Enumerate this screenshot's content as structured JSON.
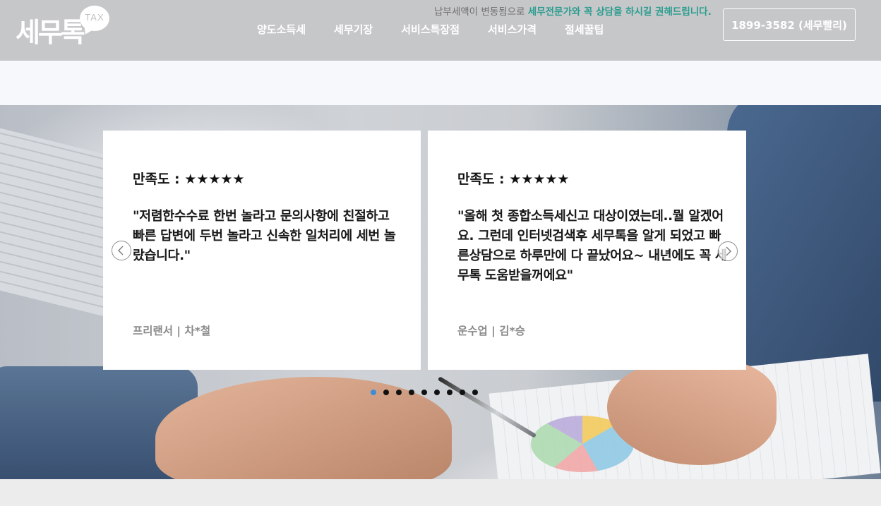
{
  "header": {
    "logo_text": "세무톡",
    "logo_badge": "TAX",
    "notice_plain": "납부세액이 변동됨으로 ",
    "notice_highlight": "세무전문가와 꼭 상담을 하시길 권해드립니다.",
    "nav": [
      "양도소득세",
      "세무기장",
      "서비스특장점",
      "서비스가격",
      "절세꿀팁"
    ],
    "phone_button": "1899-3582 (세무빨리)"
  },
  "reviews": [
    {
      "rating_label": "만족도 : ",
      "stars": "★★★★★",
      "quote": "\"저렴한수수료 한번 놀라고 문의사항에 친절하고 빠른 답변에 두번 놀라고 신속한 일처리에 세번 놀랐습니다.\"",
      "author": "프리랜서 | 차*철"
    },
    {
      "rating_label": "만족도 : ",
      "stars": "★★★★★",
      "quote": "\"올해 첫 종합소득세신고 대상이였는데..뭘 알겠어요. 그런데 인터넷검색후 세무톡을 알게 되었고 빠른상담으로 하루만에 다 끝났어요~ 내년에도 꼭 세무톡 도움받을꺼에요\"",
      "author": "운수업 | 김*승"
    }
  ],
  "carousel": {
    "dot_count": 9,
    "active_index": 0,
    "active_color": "#3b8ed6",
    "prev_icon": "chevron-left-icon",
    "next_icon": "chevron-right-icon"
  },
  "colors": {
    "header_bg": "#c6c7c9",
    "highlight": "#2a9d8f"
  }
}
